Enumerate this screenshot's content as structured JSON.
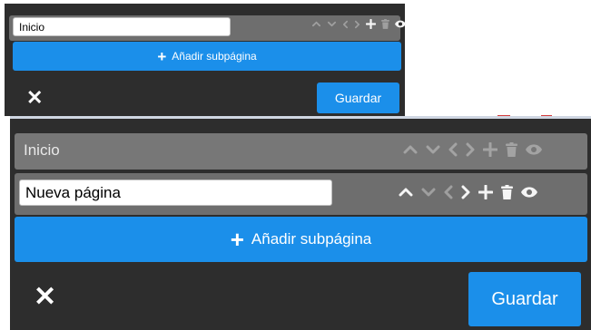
{
  "colors": {
    "panel_bg": "#2d2d2d",
    "row_bg": "#6e6e6e",
    "accent_blue": "#1b8fea",
    "text_light": "#ffffff"
  },
  "icons": [
    "chevron-up-icon",
    "chevron-down-icon",
    "chevron-left-icon",
    "chevron-right-icon",
    "plus-icon",
    "trash-icon",
    "eye-icon"
  ],
  "editor_small": {
    "page_input_value": "Inicio",
    "add_subpage_label": "Añadir subpágina",
    "close_symbol": "✕",
    "save_label": "Guardar"
  },
  "editor_large": {
    "rows": [
      {
        "title": "Inicio"
      }
    ],
    "new_page_input_value": "Nueva página",
    "add_subpage_label": "Añadir subpágina",
    "close_symbol": "✕",
    "save_label": "Guardar"
  }
}
